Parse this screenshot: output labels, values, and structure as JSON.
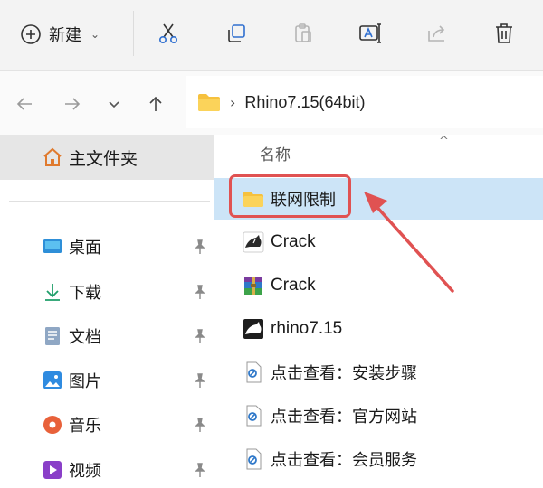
{
  "toolbar": {
    "new_label": "新建",
    "buttons": [
      "cut-icon",
      "copy-icon",
      "paste-icon",
      "rename-icon",
      "share-icon",
      "delete-icon"
    ]
  },
  "navigation": {
    "buttons": [
      "back-arrow-icon",
      "forward-arrow-icon",
      "chevron-down-icon",
      "up-arrow-icon"
    ]
  },
  "address": {
    "current_folder": "Rhino7.15(64bit)"
  },
  "sidebar": {
    "home_label": "主文件夹",
    "items": [
      {
        "label": "桌面",
        "icon": "desktop-icon"
      },
      {
        "label": "下载",
        "icon": "download-icon"
      },
      {
        "label": "文档",
        "icon": "document-icon"
      },
      {
        "label": "图片",
        "icon": "picture-icon"
      },
      {
        "label": "音乐",
        "icon": "music-icon"
      },
      {
        "label": "视频",
        "icon": "video-icon"
      }
    ]
  },
  "files": {
    "column_header": "名称",
    "items": [
      {
        "name": "联网限制",
        "icon": "folder-icon",
        "selected": true
      },
      {
        "name": "Crack",
        "icon": "rhino-app-icon"
      },
      {
        "name": "Crack",
        "icon": "archive-icon"
      },
      {
        "name": "rhino7.15",
        "icon": "rhino-app-icon"
      },
      {
        "name": "点击查看：安装步骤",
        "icon": "link-file-icon"
      },
      {
        "name": "点击查看：官方网站",
        "icon": "link-file-icon"
      },
      {
        "name": "点击查看：会员服务",
        "icon": "link-file-icon"
      }
    ]
  },
  "colors": {
    "selection": "#cce4f7",
    "annotation": "#e05252",
    "folder": "#f6c13e"
  }
}
